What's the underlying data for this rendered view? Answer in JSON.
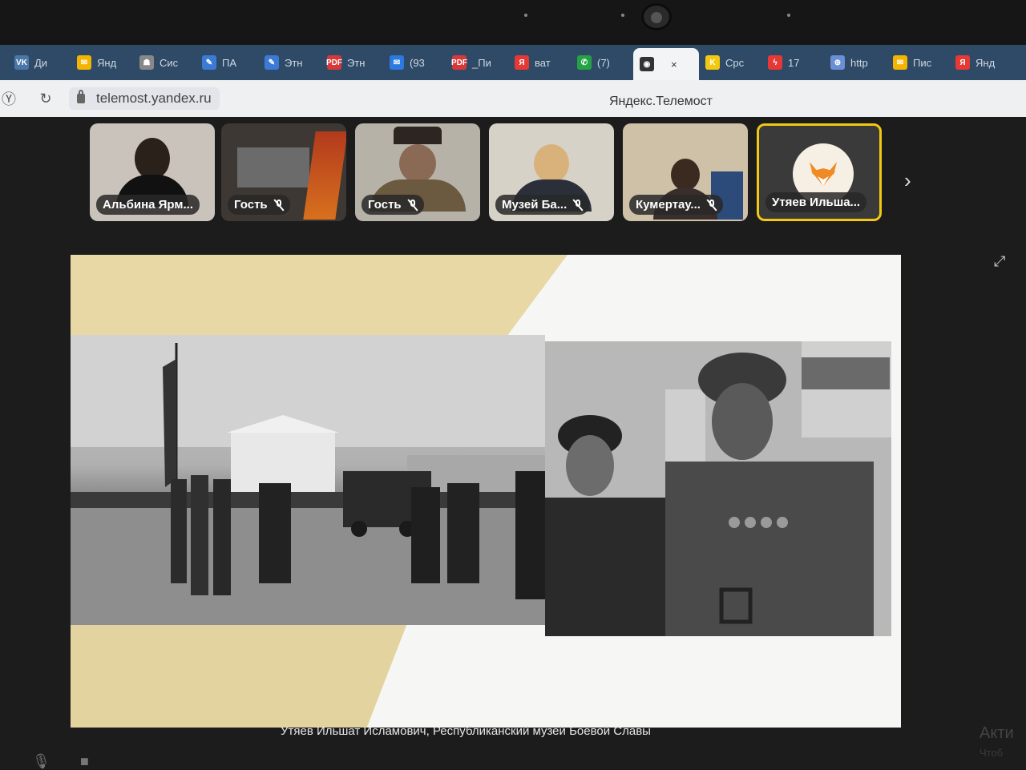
{
  "browser": {
    "tabs": [
      {
        "label": "Ди",
        "icon": "vk-icon",
        "color": "#4a76a8",
        "glyph": "VK"
      },
      {
        "label": "Янд",
        "icon": "yandex-mail-icon",
        "color": "#f5b400",
        "glyph": "✉"
      },
      {
        "label": "Сис",
        "icon": "site-icon",
        "color": "#888888",
        "glyph": "☗"
      },
      {
        "label": "ПА",
        "icon": "feather-icon",
        "color": "#3b7bd6",
        "glyph": "✎"
      },
      {
        "label": "Этн",
        "icon": "feather-icon",
        "color": "#3b7bd6",
        "glyph": "✎"
      },
      {
        "label": "Этн",
        "icon": "pdf-icon",
        "color": "#d9383a",
        "glyph": "PDF"
      },
      {
        "label": "(93",
        "icon": "mail-icon",
        "color": "#2a7ae2",
        "glyph": "✉"
      },
      {
        "label": "_Пи",
        "icon": "pdf-icon",
        "color": "#d9383a",
        "glyph": "PDF"
      },
      {
        "label": "ват",
        "icon": "yandex-icon",
        "color": "#e53935",
        "glyph": "Я"
      },
      {
        "label": "(7)",
        "icon": "whatsapp-icon",
        "color": "#25a244",
        "glyph": "✆"
      },
      {
        "label": "",
        "icon": "telemost-icon",
        "color": "#333333",
        "glyph": "◉",
        "active": true
      },
      {
        "label": "Срс",
        "icon": "k-icon",
        "color": "#f2c811",
        "glyph": "K"
      },
      {
        "label": "17",
        "icon": "lightning-icon",
        "color": "#e53935",
        "glyph": "ϟ"
      },
      {
        "label": "http",
        "icon": "globe-icon",
        "color": "#6a8fd6",
        "glyph": "⊕"
      },
      {
        "label": "Пис",
        "icon": "yandex-mail-icon",
        "color": "#f5b400",
        "glyph": "✉"
      },
      {
        "label": "Янд",
        "icon": "yandex-icon",
        "color": "#e53935",
        "glyph": "Я"
      }
    ],
    "url": "telemost.yandex.ru",
    "page_title": "Яндекс.Телемост"
  },
  "participants": [
    {
      "name": "Альбина Ярм...",
      "muted": false,
      "bg": "#c9c3bb"
    },
    {
      "name": "Гость",
      "muted": true,
      "bg": "#3d3833"
    },
    {
      "name": "Гость",
      "muted": true,
      "bg": "#b7b2a8"
    },
    {
      "name": "Музей Ба...",
      "muted": true,
      "bg": "#d7d2c8"
    },
    {
      "name": "Кумертау...",
      "muted": true,
      "bg": "#cfc0a8"
    },
    {
      "name": "Утяев Ильша...",
      "muted": false,
      "bg": "#3a3a3a",
      "active": true
    }
  ],
  "caption": "Утяев Ильшат Исламович, Республиканский музей Боевой Славы",
  "watermark": {
    "line1": "Акти",
    "line2": "Чтоб"
  },
  "colors": {
    "active_speaker": "#f2c811",
    "slide_accent": "#e7d8a6"
  }
}
